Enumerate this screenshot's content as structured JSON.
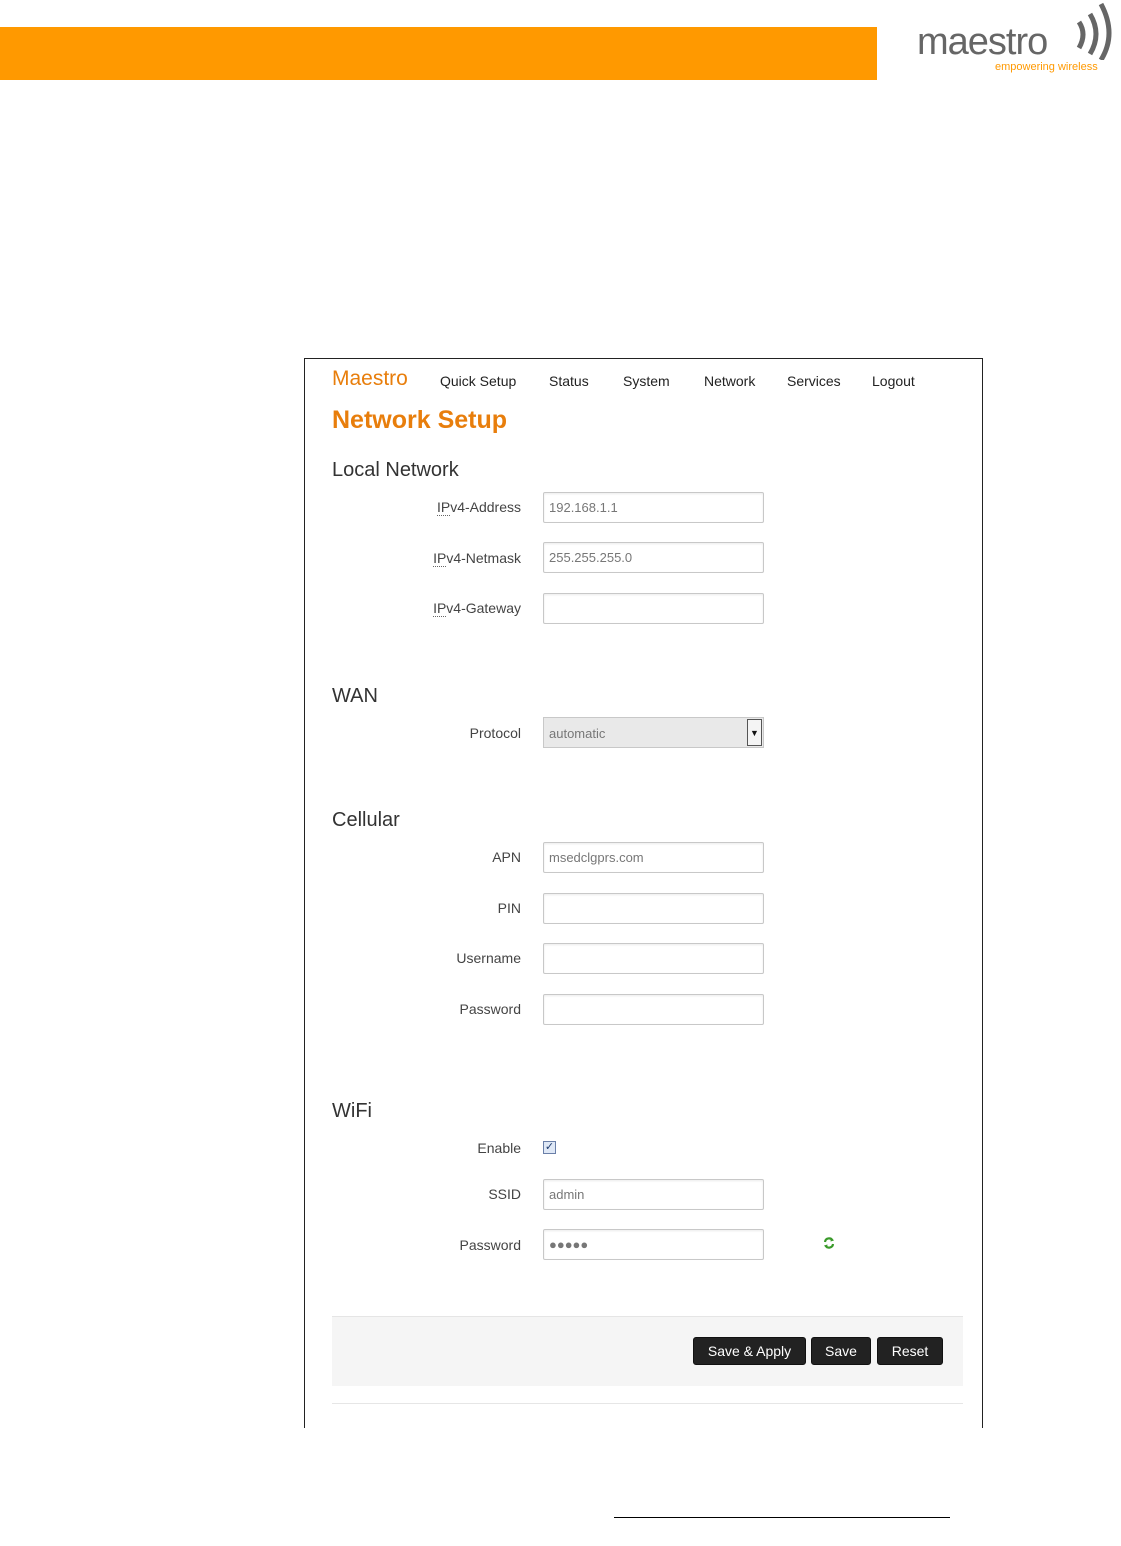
{
  "logo": {
    "brand": "maestro",
    "tagline": "empowering wireless"
  },
  "app": {
    "brand": "Maestro"
  },
  "nav": [
    "Quick Setup",
    "Status",
    "System",
    "Network",
    "Services",
    "Logout"
  ],
  "page_title": "Network Setup",
  "local_network": {
    "title": "Local Network",
    "ipv4_address": {
      "label_abbr": "IP",
      "label_rest": "v4-Address",
      "value": "192.168.1.1"
    },
    "ipv4_netmask": {
      "label_abbr": "IP",
      "label_rest": "v4-Netmask",
      "value": "255.255.255.0"
    },
    "ipv4_gateway": {
      "label_abbr": "IP",
      "label_rest": "v4-Gateway",
      "value": ""
    }
  },
  "wan": {
    "title": "WAN",
    "protocol": {
      "label": "Protocol",
      "value": "automatic"
    }
  },
  "cellular": {
    "title": "Cellular",
    "apn": {
      "label": "APN",
      "value": "msedclgprs.com"
    },
    "pin": {
      "label": "PIN",
      "value": ""
    },
    "username": {
      "label": "Username",
      "value": ""
    },
    "password": {
      "label": "Password",
      "value": ""
    }
  },
  "wifi": {
    "title": "WiFi",
    "enable": {
      "label": "Enable",
      "checked": true
    },
    "ssid": {
      "label": "SSID",
      "value": "admin"
    },
    "password": {
      "label": "Password",
      "value": "●●●●●"
    }
  },
  "actions": {
    "save_apply": "Save & Apply",
    "save": "Save",
    "reset": "Reset"
  },
  "colors": {
    "accent": "#ff9900",
    "brand_text": "#e87e0c",
    "button_bg": "#222222"
  }
}
